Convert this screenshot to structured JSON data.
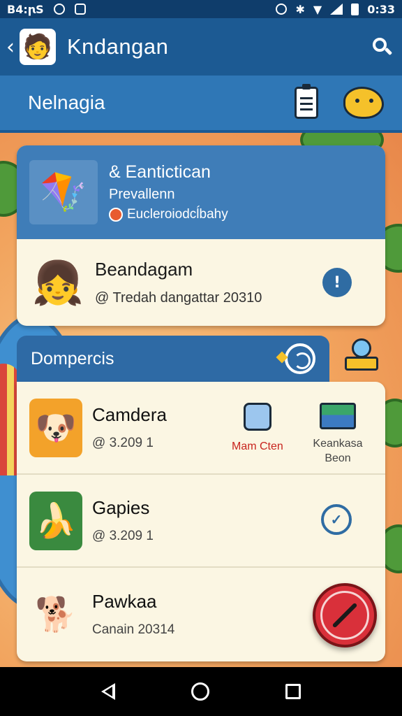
{
  "status_bar": {
    "time": "B4:ꞃS",
    "clock": "0:33",
    "icons": [
      "sync-icon",
      "image-icon",
      "alarm-icon",
      "bluetooth-icon",
      "wifi-icon",
      "signal-icon",
      "battery-icon"
    ]
  },
  "app_bar": {
    "title": "Kndangan",
    "icons": [
      "back-icon",
      "app-avatar",
      "search-icon"
    ]
  },
  "section": {
    "title": "Nelnagia",
    "icons": [
      "clipboard-icon",
      "fish-icon"
    ]
  },
  "featured": {
    "title": "& Eantictican",
    "subtitle": "Prevallenn",
    "tag": "Eucleroiodcĺbahy",
    "user_name": "Beandagam",
    "user_meta": "@ Tredah dangattar 20310",
    "alert_symbol": "!"
  },
  "list": {
    "title": "Dompercis",
    "items": [
      {
        "name": "Camdera",
        "meta": "@ 3.209 1",
        "action_primary": "Mam Cten",
        "action_secondary": "Keankasa Beon"
      },
      {
        "name": "Gapies",
        "meta": "@ 3.209 1",
        "action_symbol": "✓"
      },
      {
        "name": "Pawkaa",
        "meta": "Canain 20314"
      }
    ]
  },
  "colors": {
    "status_bar": "#0f3d6b",
    "app_bar": "#1c5a93",
    "section_bar": "#2f77b6",
    "card_cream": "#fbf6e3",
    "accent_red": "#d9303a"
  },
  "nav_bar": {
    "icons": [
      "nav-back-icon",
      "nav-home-icon",
      "nav-recents-icon"
    ]
  }
}
